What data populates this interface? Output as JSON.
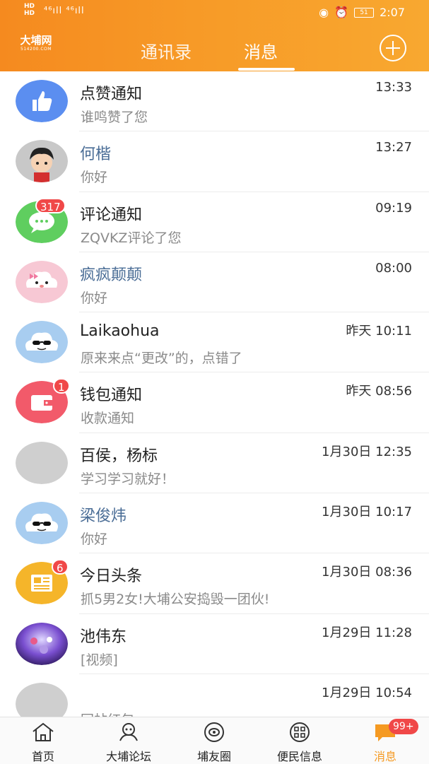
{
  "statusbar": {
    "hd_top": "HD",
    "hd_bottom": "HD",
    "signals": "⁴⁶ıll ⁴⁶ıll",
    "battery": "51",
    "time": "2:07"
  },
  "header": {
    "logo_text": "大埔网",
    "logo_sub": "514200.COM",
    "tabs": [
      {
        "label": "通讯录",
        "active": false
      },
      {
        "label": "消息",
        "active": true
      }
    ]
  },
  "messages": [
    {
      "name": "点赞通知",
      "preview": "谁鸣赞了您",
      "time": "13:33",
      "badge": "",
      "avatar": "like-icon",
      "name_blue": false
    },
    {
      "name": "何楷",
      "preview": "你好",
      "time": "13:27",
      "badge": "",
      "avatar": "cartoon-girl",
      "name_blue": true
    },
    {
      "name": "评论通知",
      "preview": "ZQVKZ评论了您",
      "time": "09:19",
      "badge": "317",
      "avatar": "comment-icon",
      "name_blue": false
    },
    {
      "name": "疯疯颠颠",
      "preview": "你好",
      "time": "08:00",
      "badge": "",
      "avatar": "cloud-bow",
      "name_blue": true
    },
    {
      "name": "Laikaohua",
      "preview": "原来来点“更改”的，点错了",
      "time": "昨天 10:11",
      "badge": "",
      "avatar": "cloud-sunglasses",
      "name_blue": false
    },
    {
      "name": "钱包通知",
      "preview": "收款通知",
      "time": "昨天 08:56",
      "badge": "1",
      "avatar": "wallet-icon",
      "name_blue": false
    },
    {
      "name": "百侯，杨标",
      "preview": "学习学习就好！",
      "time": "1月30日 12:35",
      "badge": "",
      "avatar": "gray",
      "name_blue": false
    },
    {
      "name": "梁俊炜",
      "preview": "你好",
      "time": "1月30日 10:17",
      "badge": "",
      "avatar": "cloud-sunglasses",
      "name_blue": true
    },
    {
      "name": "今日头条",
      "preview": "抓5男2女!大埔公安捣毁一团伙!",
      "time": "1月30日 08:36",
      "badge": "6",
      "avatar": "news-icon",
      "name_blue": false
    },
    {
      "name": "池伟东",
      "preview": "[视频]",
      "time": "1月29日 11:28",
      "badge": "",
      "avatar": "photo",
      "name_blue": false
    },
    {
      "name": "",
      "preview": "回帖红包",
      "time": "1月29日 10:54",
      "badge": "",
      "avatar": "gray",
      "name_blue": false
    }
  ],
  "bottomnav": {
    "items": [
      {
        "label": "首页",
        "icon": "home-icon",
        "active": false
      },
      {
        "label": "大埔论坛",
        "icon": "forum-icon",
        "active": false
      },
      {
        "label": "埔友圈",
        "icon": "circle-icon",
        "active": false
      },
      {
        "label": "便民信息",
        "icon": "service-icon",
        "active": false
      },
      {
        "label": "消息",
        "icon": "message-icon",
        "active": true
      }
    ],
    "message_badge": "99+"
  },
  "colors": {
    "header_start": "#f58a1f",
    "header_end": "#f8a830",
    "badge": "#f04848",
    "active_nav": "#f59a22",
    "name_blue": "#4a6d96"
  }
}
